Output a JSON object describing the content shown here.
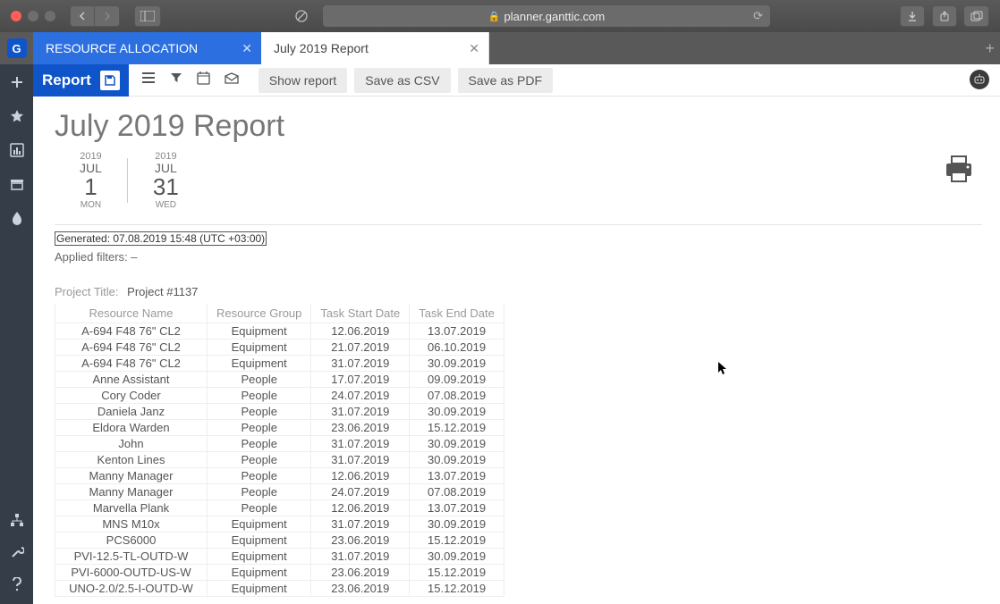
{
  "browser": {
    "url": "planner.ganttic.com"
  },
  "tabs": [
    {
      "label": "RESOURCE ALLOCATION",
      "active": true
    },
    {
      "label": "July 2019 Report",
      "active": false
    }
  ],
  "toolbar": {
    "report_label": "Report",
    "buttons": {
      "show": "Show report",
      "csv": "Save as CSV",
      "pdf": "Save as PDF"
    }
  },
  "report": {
    "title": "July 2019 Report",
    "start": {
      "year": "2019",
      "month": "JUL",
      "day": "1",
      "weekday": "MON"
    },
    "end": {
      "year": "2019",
      "month": "JUL",
      "day": "31",
      "weekday": "WED"
    },
    "generated": "Generated: 07.08.2019 15:48 (UTC +03:00)",
    "applied_filters_label": "Applied filters: ",
    "applied_filters_value": "–",
    "project_label": "Project Title:",
    "project_value": "Project #1137",
    "columns": [
      "Resource Name",
      "Resource Group",
      "Task Start Date",
      "Task End Date"
    ],
    "rows": [
      [
        "A-694 F48 76\" CL2",
        "Equipment",
        "12.06.2019",
        "13.07.2019"
      ],
      [
        "A-694 F48 76\" CL2",
        "Equipment",
        "21.07.2019",
        "06.10.2019"
      ],
      [
        "A-694 F48 76\" CL2",
        "Equipment",
        "31.07.2019",
        "30.09.2019"
      ],
      [
        "Anne Assistant",
        "People",
        "17.07.2019",
        "09.09.2019"
      ],
      [
        "Cory Coder",
        "People",
        "24.07.2019",
        "07.08.2019"
      ],
      [
        "Daniela Janz",
        "People",
        "31.07.2019",
        "30.09.2019"
      ],
      [
        "Eldora Warden",
        "People",
        "23.06.2019",
        "15.12.2019"
      ],
      [
        "John",
        "People",
        "31.07.2019",
        "30.09.2019"
      ],
      [
        "Kenton Lines",
        "People",
        "31.07.2019",
        "30.09.2019"
      ],
      [
        "Manny Manager",
        "People",
        "12.06.2019",
        "13.07.2019"
      ],
      [
        "Manny Manager",
        "People",
        "24.07.2019",
        "07.08.2019"
      ],
      [
        "Marvella Plank",
        "People",
        "12.06.2019",
        "13.07.2019"
      ],
      [
        "MNS M10x",
        "Equipment",
        "31.07.2019",
        "30.09.2019"
      ],
      [
        "PCS6000",
        "Equipment",
        "23.06.2019",
        "15.12.2019"
      ],
      [
        "PVI-12.5-TL-OUTD-W",
        "Equipment",
        "31.07.2019",
        "30.09.2019"
      ],
      [
        "PVI-6000-OUTD-US-W",
        "Equipment",
        "23.06.2019",
        "15.12.2019"
      ],
      [
        "UNO-2.0/2.5-I-OUTD-W",
        "Equipment",
        "23.06.2019",
        "15.12.2019"
      ]
    ]
  }
}
